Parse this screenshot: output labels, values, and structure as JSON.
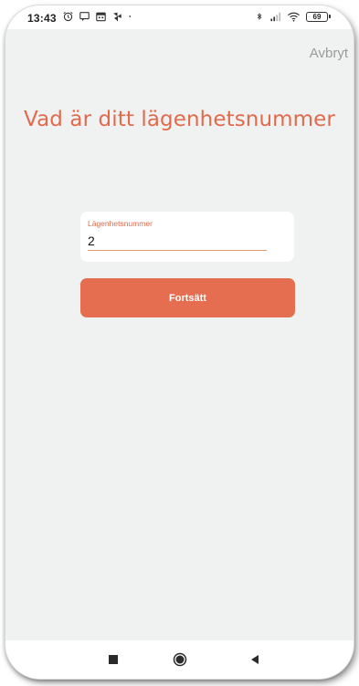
{
  "status_bar": {
    "time": "13:43",
    "battery_level": "69",
    "left_icons": [
      "alarm-icon",
      "chat-icon",
      "calendar-icon",
      "pinwheel-icon",
      "dot-icon"
    ],
    "right_icons": [
      "bluetooth-icon",
      "signal-icon",
      "wifi-icon",
      "battery-icon"
    ]
  },
  "header": {
    "cancel_label": "Avbryt"
  },
  "main": {
    "title": "Vad är ditt lägenhetsnummer",
    "apartment_field": {
      "label": "Lägenhetsnummer",
      "value": "2"
    },
    "continue_label": "Fortsätt"
  },
  "nav_bar": {
    "buttons": [
      "recents-icon",
      "home-icon",
      "back-icon"
    ]
  },
  "colors": {
    "accent": "#e46e4f",
    "background": "#f0f2f1",
    "muted_text": "#9b9b9b"
  }
}
